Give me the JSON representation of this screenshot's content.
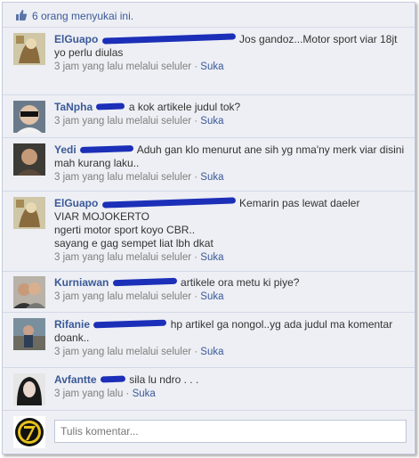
{
  "likes": {
    "icon": "thumbs-up-icon",
    "text": "6 orang menyukai ini."
  },
  "comments": [
    {
      "author": "ElGuapo",
      "text": "Jos gandoz...Motor sport viar 18jt\nyo perlu diulas",
      "time": "3 jam yang lalu melalui seluler",
      "like_label": "Suka",
      "avatar": "avatar-sketch-icon"
    },
    {
      "author": "TaNpha",
      "text": "a kok artikele judul tok?",
      "time": "3 jam yang lalu melalui seluler",
      "like_label": "Suka",
      "avatar": "avatar-sunglasses-icon"
    },
    {
      "author": "Yedi",
      "text": "Aduh gan klo menurut ane sih yg nma'ny merk viar disini mah kurang laku..",
      "time": "3 jam yang lalu melalui seluler",
      "like_label": "Suka",
      "avatar": "avatar-photo-icon"
    },
    {
      "author": "ElGuapo",
      "text": "Kemarin pas lewat daeler\nVIAR MOJOKERTO\nngerti motor sport koyo CBR..\nsayang e gag sempet liat lbh dkat",
      "time": "3 jam yang lalu melalui seluler",
      "like_label": "Suka",
      "avatar": "avatar-sketch-icon"
    },
    {
      "author": "Kurniawan",
      "text": "artikele ora metu ki piye?",
      "time": "3 jam yang lalu melalui seluler",
      "like_label": "Suka",
      "avatar": "avatar-couple-icon"
    },
    {
      "author": "Rifanie",
      "text": "hp artikel ga nongol..yg ada judul ma komentar doank..",
      "time": "3 jam yang lalu melalui seluler",
      "like_label": "Suka",
      "avatar": "avatar-street-icon"
    },
    {
      "author": "Avfantte",
      "text": "sila lu ndro . . .",
      "time": "3 jam yang lalu",
      "like_label": "Suka",
      "avatar": "avatar-dark-hair-icon"
    }
  ],
  "composer": {
    "placeholder": "Tulis komentar...",
    "avatar": "avatar-number-seven-icon"
  },
  "colors": {
    "link": "#3b5998",
    "background": "#edeff4",
    "scribble": "#1c2fb8"
  }
}
